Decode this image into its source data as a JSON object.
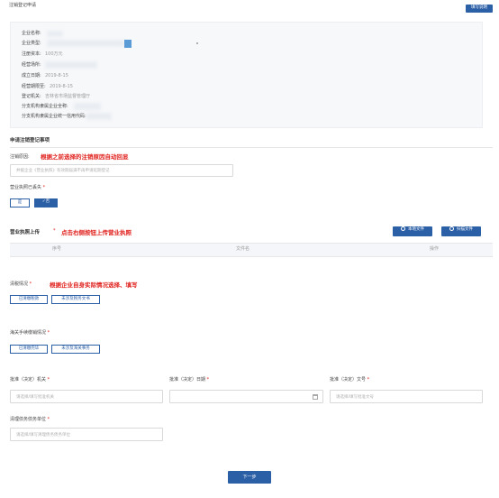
{
  "page": {
    "title": "注销登记申请",
    "top_button": "填写说明"
  },
  "company_info": {
    "rows": [
      {
        "label": "企业名称:",
        "value": ""
      },
      {
        "label": "企业类型:",
        "value": ""
      },
      {
        "label": "注册资本:",
        "value": "100万元"
      },
      {
        "label": "经营场所:",
        "value": ""
      },
      {
        "label": "成立日期:",
        "value": "2019-8-15"
      },
      {
        "label": "经营期限至:",
        "value": "2019-8-15"
      },
      {
        "label": "登记机关:",
        "value": "吉林省市场监督管理厅"
      },
      {
        "label": "分支机构隶属企业全称:",
        "value": ""
      },
      {
        "label": "分支机构隶属企业统一信用代码:",
        "value": ""
      }
    ],
    "accent_color": "#5b9bd5"
  },
  "apply_section": {
    "title": "申请注销登记事项",
    "reason_label": "注销原因:",
    "reason_note": "根据之前选择的注销原因自动回显",
    "reason_placeholder": "并据企业《营业执照》有效期届满不再申请延期登记"
  },
  "license_lost": {
    "label": "营业执照已丢失",
    "options": [
      "是",
      "✓否"
    ],
    "selected": "✓否"
  },
  "license_upload": {
    "label": "营业执照上传",
    "note": "点击右侧按钮上传营业执照",
    "btn_local": "本地文件",
    "btn_scan": "扫描文件",
    "columns": [
      "序号",
      "文件名",
      "操作"
    ]
  },
  "tax": {
    "label": "清税情况",
    "note": "根据企业自身实际情况选择、填写",
    "options": [
      "已清缴税款",
      "未涉及税务文书"
    ]
  },
  "customs": {
    "label": "海关手续缴销情况",
    "options": [
      "已清缴完毕",
      "未涉及海关事务"
    ]
  },
  "approval": {
    "authority_label": "批准（决定）机关",
    "authority_placeholder": "请选择/填写批准机关",
    "date_label": "批准（决定）日期",
    "doc_label": "批准（决定）文号",
    "doc_placeholder": "请选择/填写批准文号"
  },
  "liquidation": {
    "label": "清理债务债务单位",
    "placeholder": "请选择/填写清理债务债务单位"
  },
  "footer": {
    "next_button": "下一步"
  },
  "colors": {
    "primary": "#2b5fa6",
    "note_red": "#e0201c"
  }
}
